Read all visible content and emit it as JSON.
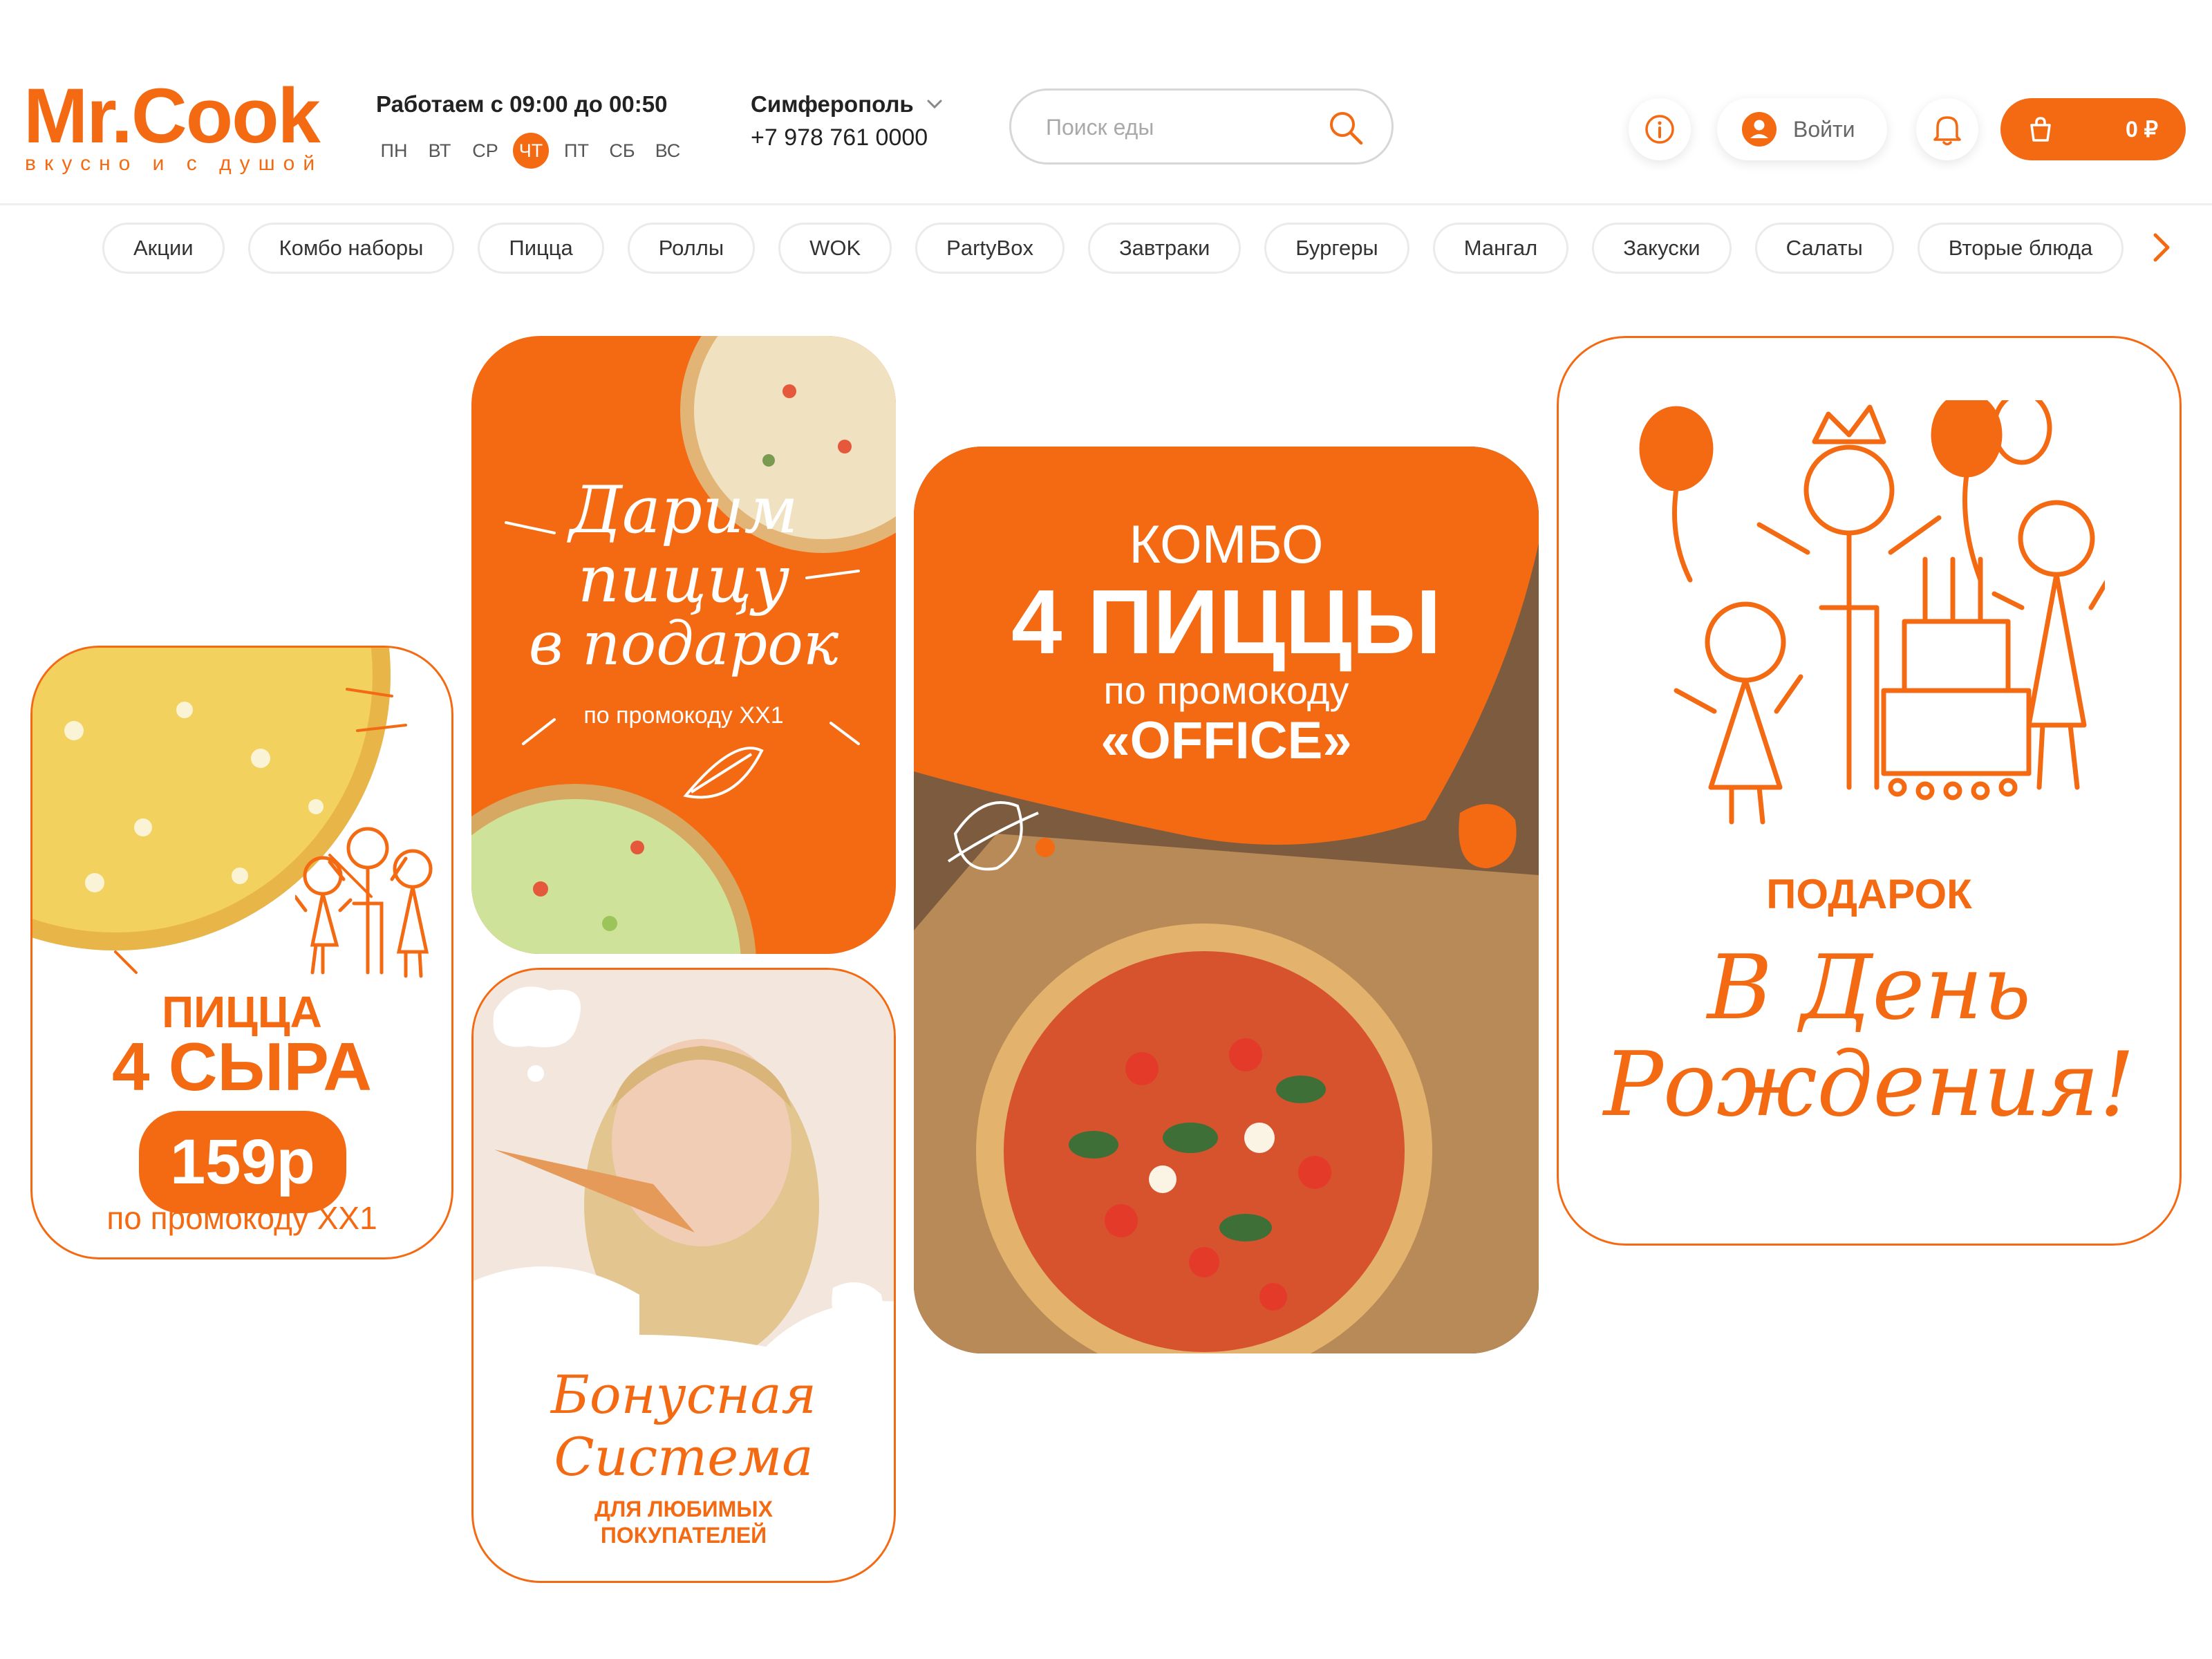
{
  "header": {
    "logo": "Mr.Cook",
    "tagline": "вкусно и с душой",
    "hours": "Работаем с 09:00 до 00:50",
    "days": [
      "ПН",
      "ВТ",
      "СР",
      "ЧТ",
      "ПТ",
      "СБ",
      "ВС"
    ],
    "active_day": "ЧТ",
    "city": "Симферополь",
    "phone": "+7 978 761 0000",
    "search_placeholder": "Поиск еды",
    "login_label": "Войти",
    "cart_total": "0 ₽"
  },
  "categories": [
    "Акции",
    "Комбо наборы",
    "Пицца",
    "Роллы",
    "WOK",
    "PartyBox",
    "Завтраки",
    "Бургеры",
    "Мангал",
    "Закуски",
    "Салаты",
    "Вторые блюда"
  ],
  "banners": {
    "four_cheese": {
      "line1": "ПИЦЦА",
      "line2": "4 СЫРА",
      "price": "159р",
      "promo": "по промокоду ХХ1"
    },
    "gift_pizza": {
      "line1": "Дарим",
      "line2": "пиццу",
      "line3": "в подарок",
      "promo": "по промокоду ХХ1"
    },
    "combo": {
      "line1": "КОМБО",
      "line2": "4 ПИЦЦЫ",
      "line3": "по промокоду",
      "line4": "«OFFICE»"
    },
    "bonus": {
      "line1": "Бонусная",
      "line2": "Система",
      "line3": "ДЛЯ ЛЮБИМЫХ",
      "line4": "ПОКУПАТЕЛЕЙ"
    },
    "birthday": {
      "line1": "ПОДАРОК",
      "line2": "В День",
      "line3": "Рождения!"
    }
  },
  "colors": {
    "accent": "#f46a13",
    "border": "#ebebeb"
  }
}
